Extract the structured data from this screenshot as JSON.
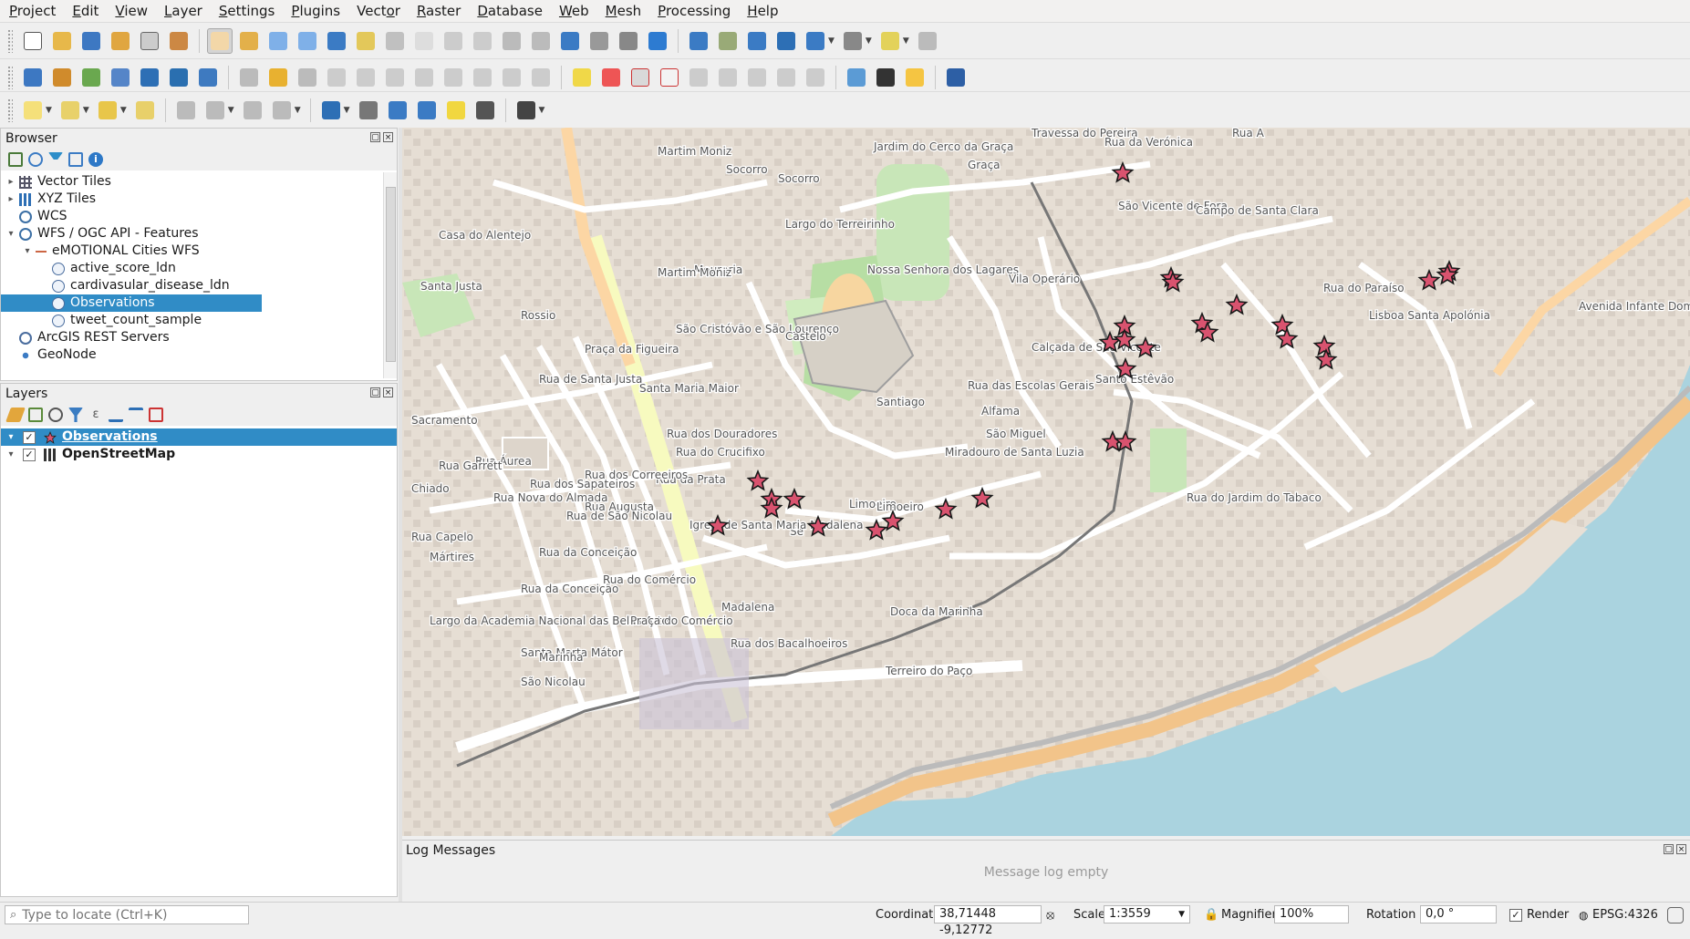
{
  "menu": [
    "Project",
    "Edit",
    "View",
    "Layer",
    "Settings",
    "Plugins",
    "Vector",
    "Raster",
    "Database",
    "Web",
    "Mesh",
    "Processing",
    "Help"
  ],
  "menu_underline": [
    "P",
    "E",
    "V",
    "L",
    "S",
    "P",
    "o",
    "R",
    "D",
    "W",
    "M",
    "P",
    "H"
  ],
  "browser": {
    "title": "Browser",
    "items": [
      {
        "label": "Vector Tiles",
        "icon": "vector-tiles-icon",
        "level": 0,
        "expander": "right"
      },
      {
        "label": "XYZ Tiles",
        "icon": "xyz-tiles-icon",
        "level": 0,
        "expander": "right"
      },
      {
        "label": "WCS",
        "icon": "wcs-icon",
        "level": 0,
        "expander": ""
      },
      {
        "label": "WFS / OGC API - Features",
        "icon": "wfs-icon",
        "level": 0,
        "expander": "down"
      },
      {
        "label": "eMOTIONAL Cities WFS",
        "icon": "connection-icon",
        "level": 1,
        "expander": "down"
      },
      {
        "label": "active_score_ldn",
        "icon": "wfs-layer-icon",
        "level": 2,
        "expander": ""
      },
      {
        "label": "cardivasular_disease_ldn",
        "icon": "wfs-layer-icon",
        "level": 2,
        "expander": ""
      },
      {
        "label": "Observations",
        "icon": "wfs-layer-icon",
        "level": 2,
        "expander": "",
        "selected": true
      },
      {
        "label": "tweet_count_sample",
        "icon": "wfs-layer-icon",
        "level": 2,
        "expander": ""
      },
      {
        "label": "ArcGIS REST Servers",
        "icon": "arcgis-icon",
        "level": 0,
        "expander": ""
      },
      {
        "label": "GeoNode",
        "icon": "geonode-icon",
        "level": 0,
        "expander": ""
      }
    ]
  },
  "layers": {
    "title": "Layers",
    "items": [
      {
        "label": "Observations",
        "icon": "star-symbol-icon",
        "checked": true,
        "selected": true
      },
      {
        "label": "OpenStreetMap",
        "icon": "raster-icon",
        "checked": true,
        "selected": false
      }
    ]
  },
  "map_labels": [
    "Martim Moniz",
    "Socorro",
    "Socorro",
    "Jardim do Cerco da Graça",
    "Graça",
    "Travessa do Pereira",
    "Rua da Verónica",
    "Rua A",
    "São Vicente de Fora",
    "Campo de Santa Clara",
    "Casa do Alentejo",
    "Largo do Terreirinho",
    "Mouraria",
    "Nossa Senhora dos Lagares",
    "Santa Justa",
    "Rossio",
    "Martim Moniz",
    "Vila Operário",
    "Rua do Paraíso",
    "Lisboa Santa Apolónia",
    "Avenida Infante Dom Henrique",
    "São Cristóvão e São Lourenço",
    "Castelo",
    "Calçada de São Vicente",
    "Praça da Figueira",
    "Santa Maria Maior",
    "Santiago",
    "Rua das Escolas Gerais",
    "Alfama",
    "Santo Estêvão",
    "Rua de Santa Justa",
    "Rua dos Douradores",
    "Rua da Prata",
    "Rua dos Correeiros",
    "Rua Augusta",
    "Rua dos Sapateiros",
    "Rua do Crucifixo",
    "Rua Áurea",
    "Rua do Jardim do Tabaco",
    "São Miguel",
    "Miradouro de Santa Luzia",
    "Limoeiro",
    "Limoeiro",
    "Sé",
    "Rua Garrett",
    "Rua Nova do Almada",
    "Rua de São Nicolau",
    "Chiado",
    "Rua Capelo",
    "Igreja de Santa Maria Madalena",
    "Rua da Conceição",
    "Rua da Conceição",
    "Rua do Comércio",
    "Mártires",
    "Santa Marta Mátor",
    "Madalena",
    "Doca da Marinha",
    "Largo da Academia Nacional das Belas Artes",
    "Praça do Comércio",
    "Marinha",
    "São Nicolau",
    "Terreiro do Paço",
    "Sacramento",
    "Rua dos Bacalhoeiros"
  ],
  "log": {
    "title": "Log Messages",
    "message": "Message log empty"
  },
  "status": {
    "locate_placeholder": "Type to locate (Ctrl+K)",
    "coordinate_label": "Coordinate",
    "coordinate_value": "38,71448 -9,12772",
    "scale_label": "Scale",
    "scale_value": "1:3559",
    "magnifier_label": "Magnifier",
    "magnifier_value": "100%",
    "rotation_label": "Rotation",
    "rotation_value": "0,0 °",
    "render_label": "Render",
    "crs": "EPSG:4326"
  },
  "observation_count": 30
}
